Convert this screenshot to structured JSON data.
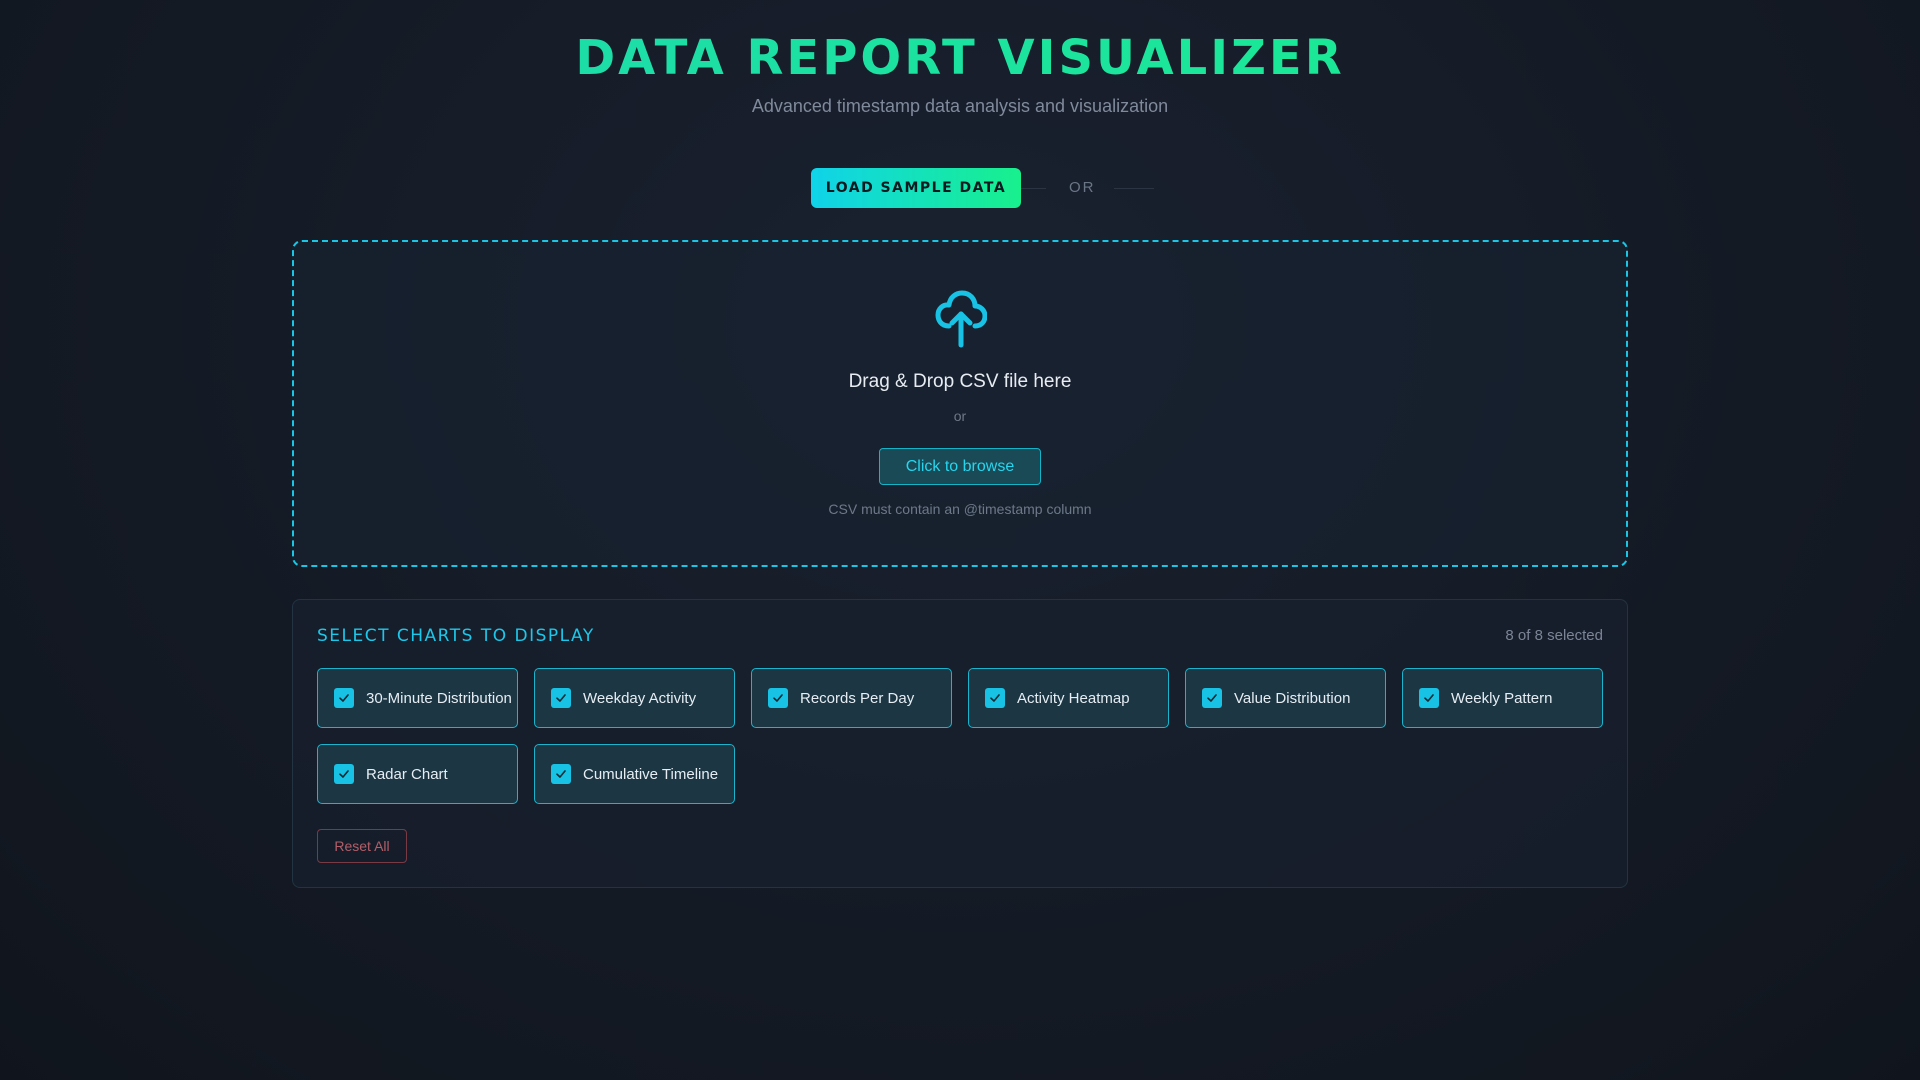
{
  "header": {
    "title": "DATA REPORT VISUALIZER",
    "subtitle": "Advanced timestamp data analysis and visualization"
  },
  "load": {
    "button_label": "LOAD SAMPLE DATA",
    "or_label": "OR"
  },
  "dropzone": {
    "icon": "cloud-upload-icon",
    "title": "Drag & Drop CSV file here",
    "or_label": "or",
    "browse_label": "Click to browse",
    "hint": "CSV must contain an @timestamp column"
  },
  "charts": {
    "title": "SELECT CHARTS TO DISPLAY",
    "selected_count": "8 of 8 selected",
    "options": [
      {
        "label": "30-Minute Distribution",
        "checked": true
      },
      {
        "label": "Weekday Activity",
        "checked": true
      },
      {
        "label": "Records Per Day",
        "checked": true
      },
      {
        "label": "Activity Heatmap",
        "checked": true
      },
      {
        "label": "Value Distribution",
        "checked": true
      },
      {
        "label": "Weekly Pattern",
        "checked": true
      },
      {
        "label": "Radar Chart",
        "checked": true
      },
      {
        "label": "Cumulative Timeline",
        "checked": true
      }
    ],
    "reset_label": "Reset All"
  },
  "colors": {
    "accent_cyan": "#17c2e4",
    "accent_green": "#18f08c",
    "danger": "#b35e68"
  }
}
